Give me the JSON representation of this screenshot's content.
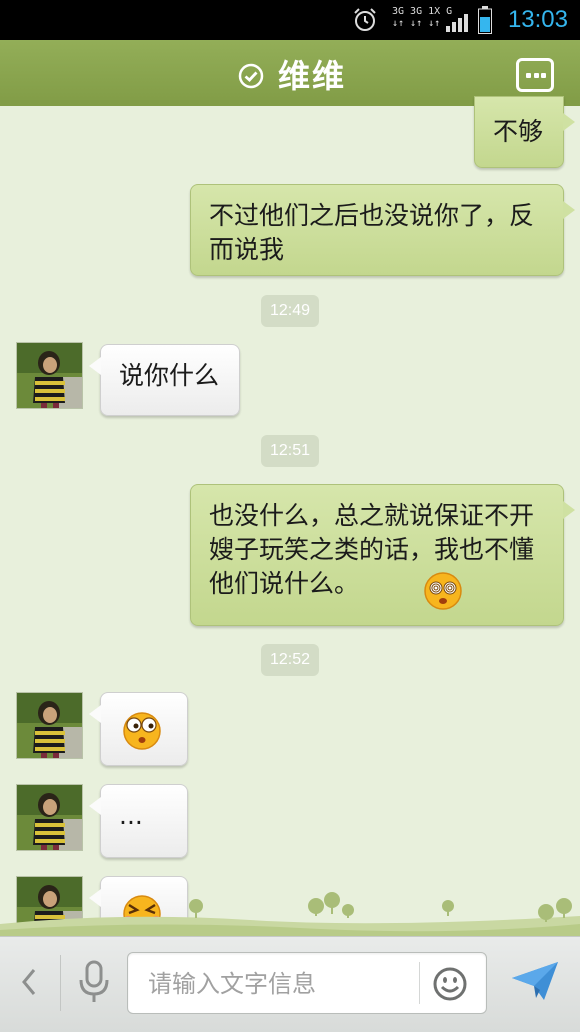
{
  "status_bar": {
    "network_line1": "3G 3G 1X G",
    "network_line2": "↓↑ ↓↑ ↓↑",
    "time": "13:03",
    "accent_color": "#35b6ee"
  },
  "header": {
    "title": "维维",
    "status_icon": "check-circle-icon",
    "menu_icon": "more-options-icon",
    "color": "#8aa64f"
  },
  "messages": [
    {
      "type": "out",
      "text": "不够"
    },
    {
      "type": "out",
      "text": "不过他们之后也没说你了，反而说我"
    },
    {
      "type": "time",
      "text": "12:49"
    },
    {
      "type": "in",
      "text": "说你什么"
    },
    {
      "type": "time",
      "text": "12:51"
    },
    {
      "type": "out",
      "text": "也没什么，总之就说保证不开嫂子玩笑之类的话，我也不懂他们说什么。",
      "emoji": "dizzy-face-emoji"
    },
    {
      "type": "time",
      "text": "12:52"
    },
    {
      "type": "in",
      "emoji": "surprised-face-emoji"
    },
    {
      "type": "in",
      "text": "..."
    },
    {
      "type": "in",
      "emoji": "frustrated-face-emoji"
    }
  ],
  "input_bar": {
    "placeholder": "请输入文字信息",
    "back_icon": "chevron-left-icon",
    "mic_icon": "microphone-icon",
    "emoji_icon": "smiley-icon",
    "send_icon": "send-icon"
  }
}
